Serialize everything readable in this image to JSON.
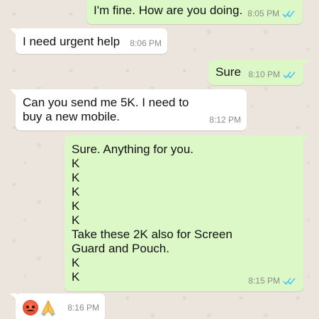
{
  "chat": {
    "accent_tick_color": "#4fc3f7",
    "outgoing_bubble_color": "#dcf8c6",
    "incoming_bubble_color": "#ffffff",
    "messages": [
      {
        "direction": "out",
        "text": "I'm fine. How are you doing.",
        "time": "8:05 PM",
        "status_icon": "double-tick-read-icon"
      },
      {
        "direction": "in",
        "text": "I need urgent help",
        "time": "8:06 PM"
      },
      {
        "direction": "out",
        "text": "Sure",
        "time": "8:10 PM",
        "status_icon": "double-tick-read-icon"
      },
      {
        "direction": "in",
        "text": "Can you send me 5K. I need to\nbuy a new mobile.",
        "time": "8:12 PM"
      },
      {
        "direction": "out",
        "text": "Sure. Anything for you.\nK\nK\nK\nK\nK\nTake these 2K also for Screen\nGuard and Pouch.\nK\nK",
        "time": "8:15 PM",
        "status_icon": "double-tick-read-icon"
      },
      {
        "direction": "in",
        "emoji": [
          "pouting-face-emoji",
          "folded-hands-emoji"
        ],
        "time": "8:16 PM"
      }
    ]
  }
}
